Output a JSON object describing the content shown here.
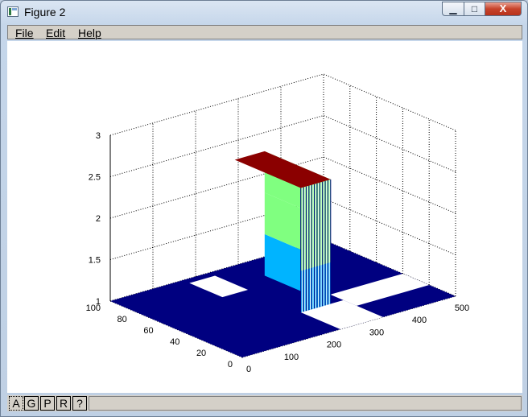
{
  "window": {
    "title": "Figure 2",
    "controls": {
      "minimize": "▁",
      "maximize": "□",
      "close": "X"
    }
  },
  "menu": {
    "items": [
      "File",
      "Edit",
      "Help"
    ]
  },
  "toolbar": {
    "buttons": [
      "A",
      "G",
      "P",
      "R",
      "?"
    ],
    "active_index": 0
  },
  "colors": {
    "plane": "#000080",
    "cyan": "#00b4ff",
    "green": "#80ff80",
    "top": "#8b0000",
    "grid": "#000000"
  },
  "chart_data": {
    "type": "surface-3d",
    "x": {
      "range": [
        0,
        500
      ],
      "ticks": [
        "0",
        "100",
        "200",
        "300",
        "400",
        "500"
      ]
    },
    "y": {
      "range": [
        0,
        100
      ],
      "ticks": [
        "0",
        "20",
        "40",
        "60",
        "80",
        "100"
      ]
    },
    "z": {
      "range": [
        1,
        3
      ],
      "ticks": [
        "1",
        "1.5",
        "2",
        "2.5",
        "3"
      ]
    },
    "grid": true,
    "base_level": 1,
    "block": {
      "x": [
        230,
        300
      ],
      "y": [
        30,
        80
      ],
      "levels": [
        1.5,
        2.0,
        2.5
      ]
    },
    "holes": [
      {
        "x": [
          170,
          230
        ],
        "y": [
          70,
          95
        ]
      },
      {
        "x": [
          230,
          330
        ],
        "y": [
          0,
          30
        ]
      },
      {
        "x": [
          330,
          500
        ],
        "y": [
          20,
          40
        ]
      }
    ]
  }
}
